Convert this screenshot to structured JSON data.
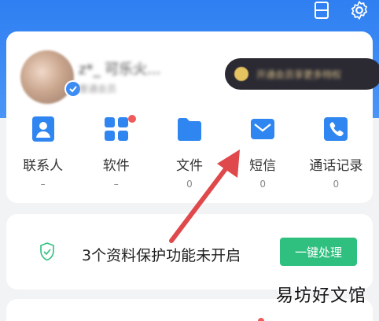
{
  "header": {
    "icons": [
      "scan-icon",
      "settings-icon"
    ]
  },
  "profile": {
    "name": "z*_ 可乐火...",
    "subtitle": "普通会员",
    "vip_text": "开通会员享更多特权"
  },
  "grid": [
    {
      "label": "联系人",
      "count": "–",
      "icon": "contact-icon",
      "color": "#2f86f0",
      "badge": false
    },
    {
      "label": "软件",
      "count": "–",
      "icon": "apps-grid-icon",
      "color": "#2f86f0",
      "badge": true
    },
    {
      "label": "文件",
      "count": "0",
      "icon": "folder-icon",
      "color": "#2f86f0",
      "badge": false
    },
    {
      "label": "短信",
      "count": "0",
      "icon": "message-icon",
      "color": "#2f86f0",
      "badge": false
    },
    {
      "label": "通话记录",
      "count": "0",
      "icon": "phone-icon",
      "color": "#2f86f0",
      "badge": false
    }
  ],
  "alert": {
    "text": "3个资料保护功能未开启",
    "button": "一键处理"
  },
  "watermark": "易坊好文馆",
  "colors": {
    "header_blue": "#2f7ff2",
    "accent_green": "#2fbf7f",
    "badge_red": "#f05a5a",
    "annotation_arrow": "#e0494c"
  }
}
